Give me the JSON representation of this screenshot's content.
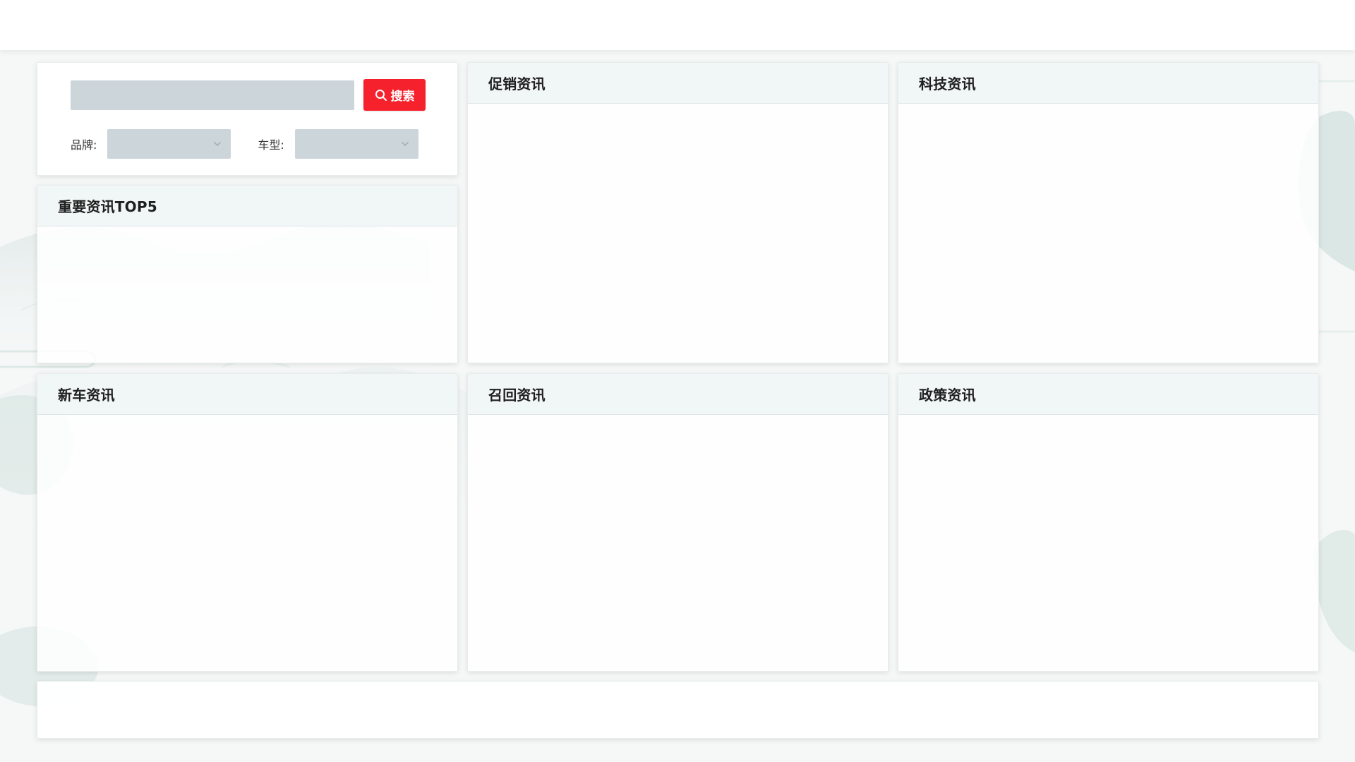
{
  "search": {
    "input_value": "",
    "placeholder": "",
    "button_label": "搜索",
    "brand_label": "品牌:",
    "brand_selected": "",
    "model_label": "车型:",
    "model_selected": ""
  },
  "panels": {
    "top5": {
      "title": "重要资讯TOP5"
    },
    "promotion": {
      "title": "促销资讯"
    },
    "technology": {
      "title": "科技资讯"
    },
    "new_car": {
      "title": "新车资讯"
    },
    "recall": {
      "title": "召回资讯"
    },
    "policy": {
      "title": "政策资讯"
    }
  },
  "colors": {
    "search_button": "#f5222d",
    "input_background": "#ccd5da",
    "panel_header": "#f0f6f5",
    "background": "#f6f8f8"
  },
  "icons": {
    "search_button_icon": "search-icon",
    "select_indicator": "chevron-down-icon"
  }
}
